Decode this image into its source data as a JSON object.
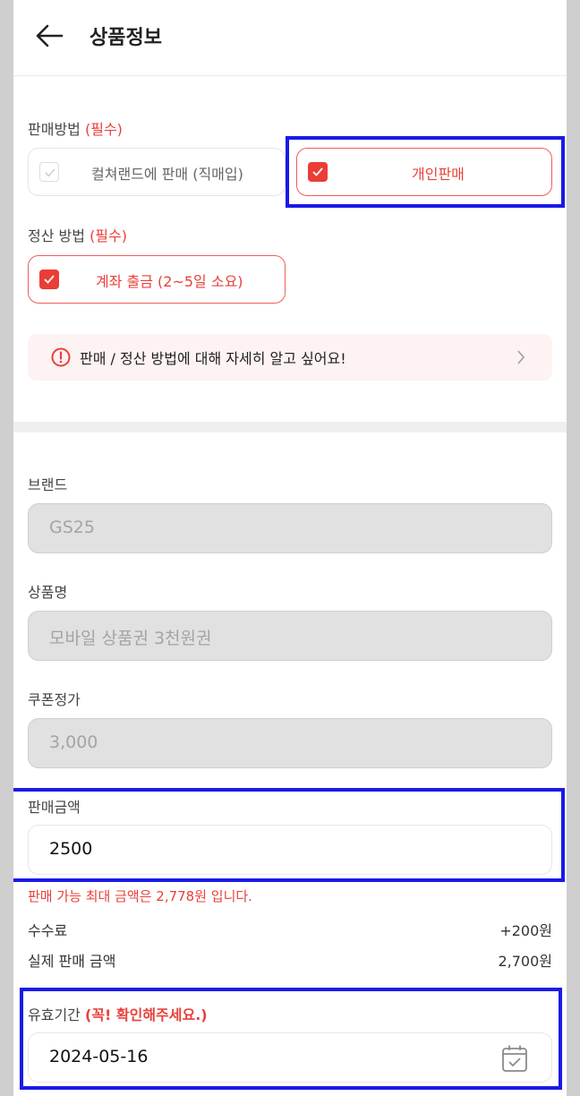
{
  "header": {
    "title": "상품정보"
  },
  "sale_method": {
    "label": "판매방법",
    "required": "(필수)",
    "options": [
      {
        "label": "컬쳐랜드에 판매 (직매입)",
        "checked": false
      },
      {
        "label": "개인판매",
        "checked": true
      }
    ]
  },
  "settlement": {
    "label": "정산 방법",
    "required": "(필수)",
    "option": {
      "label": "계좌 출금 (2~5일 소요)",
      "checked": true
    }
  },
  "info_banner": {
    "text": "판매 / 정산 방법에 대해 자세히 알고 싶어요!"
  },
  "fields": {
    "brand": {
      "label": "브랜드",
      "value": "GS25"
    },
    "product_name": {
      "label": "상품명",
      "value": "모바일 상품권 3천원권"
    },
    "coupon_price": {
      "label": "쿠폰정가",
      "value": "3,000"
    },
    "sale_amount": {
      "label": "판매금액",
      "value": "2500"
    }
  },
  "max_notice": "판매 가능 최대 금액은 2,778원 입니다.",
  "fee": {
    "label": "수수료",
    "value": "+200원"
  },
  "actual": {
    "label": "실제 판매 금액",
    "value": "2,700원"
  },
  "expiry": {
    "label": "유효기간",
    "note": "(꼭! 확인해주세요.)",
    "value": "2024-05-16"
  },
  "colors": {
    "accent": "#e8413a",
    "highlight": "#1a1ae6",
    "info_bg": "#fdf3f2"
  },
  "icons": [
    "back-arrow-icon",
    "check-icon",
    "alert-circle-icon",
    "chevron-right-icon",
    "calendar-icon"
  ]
}
